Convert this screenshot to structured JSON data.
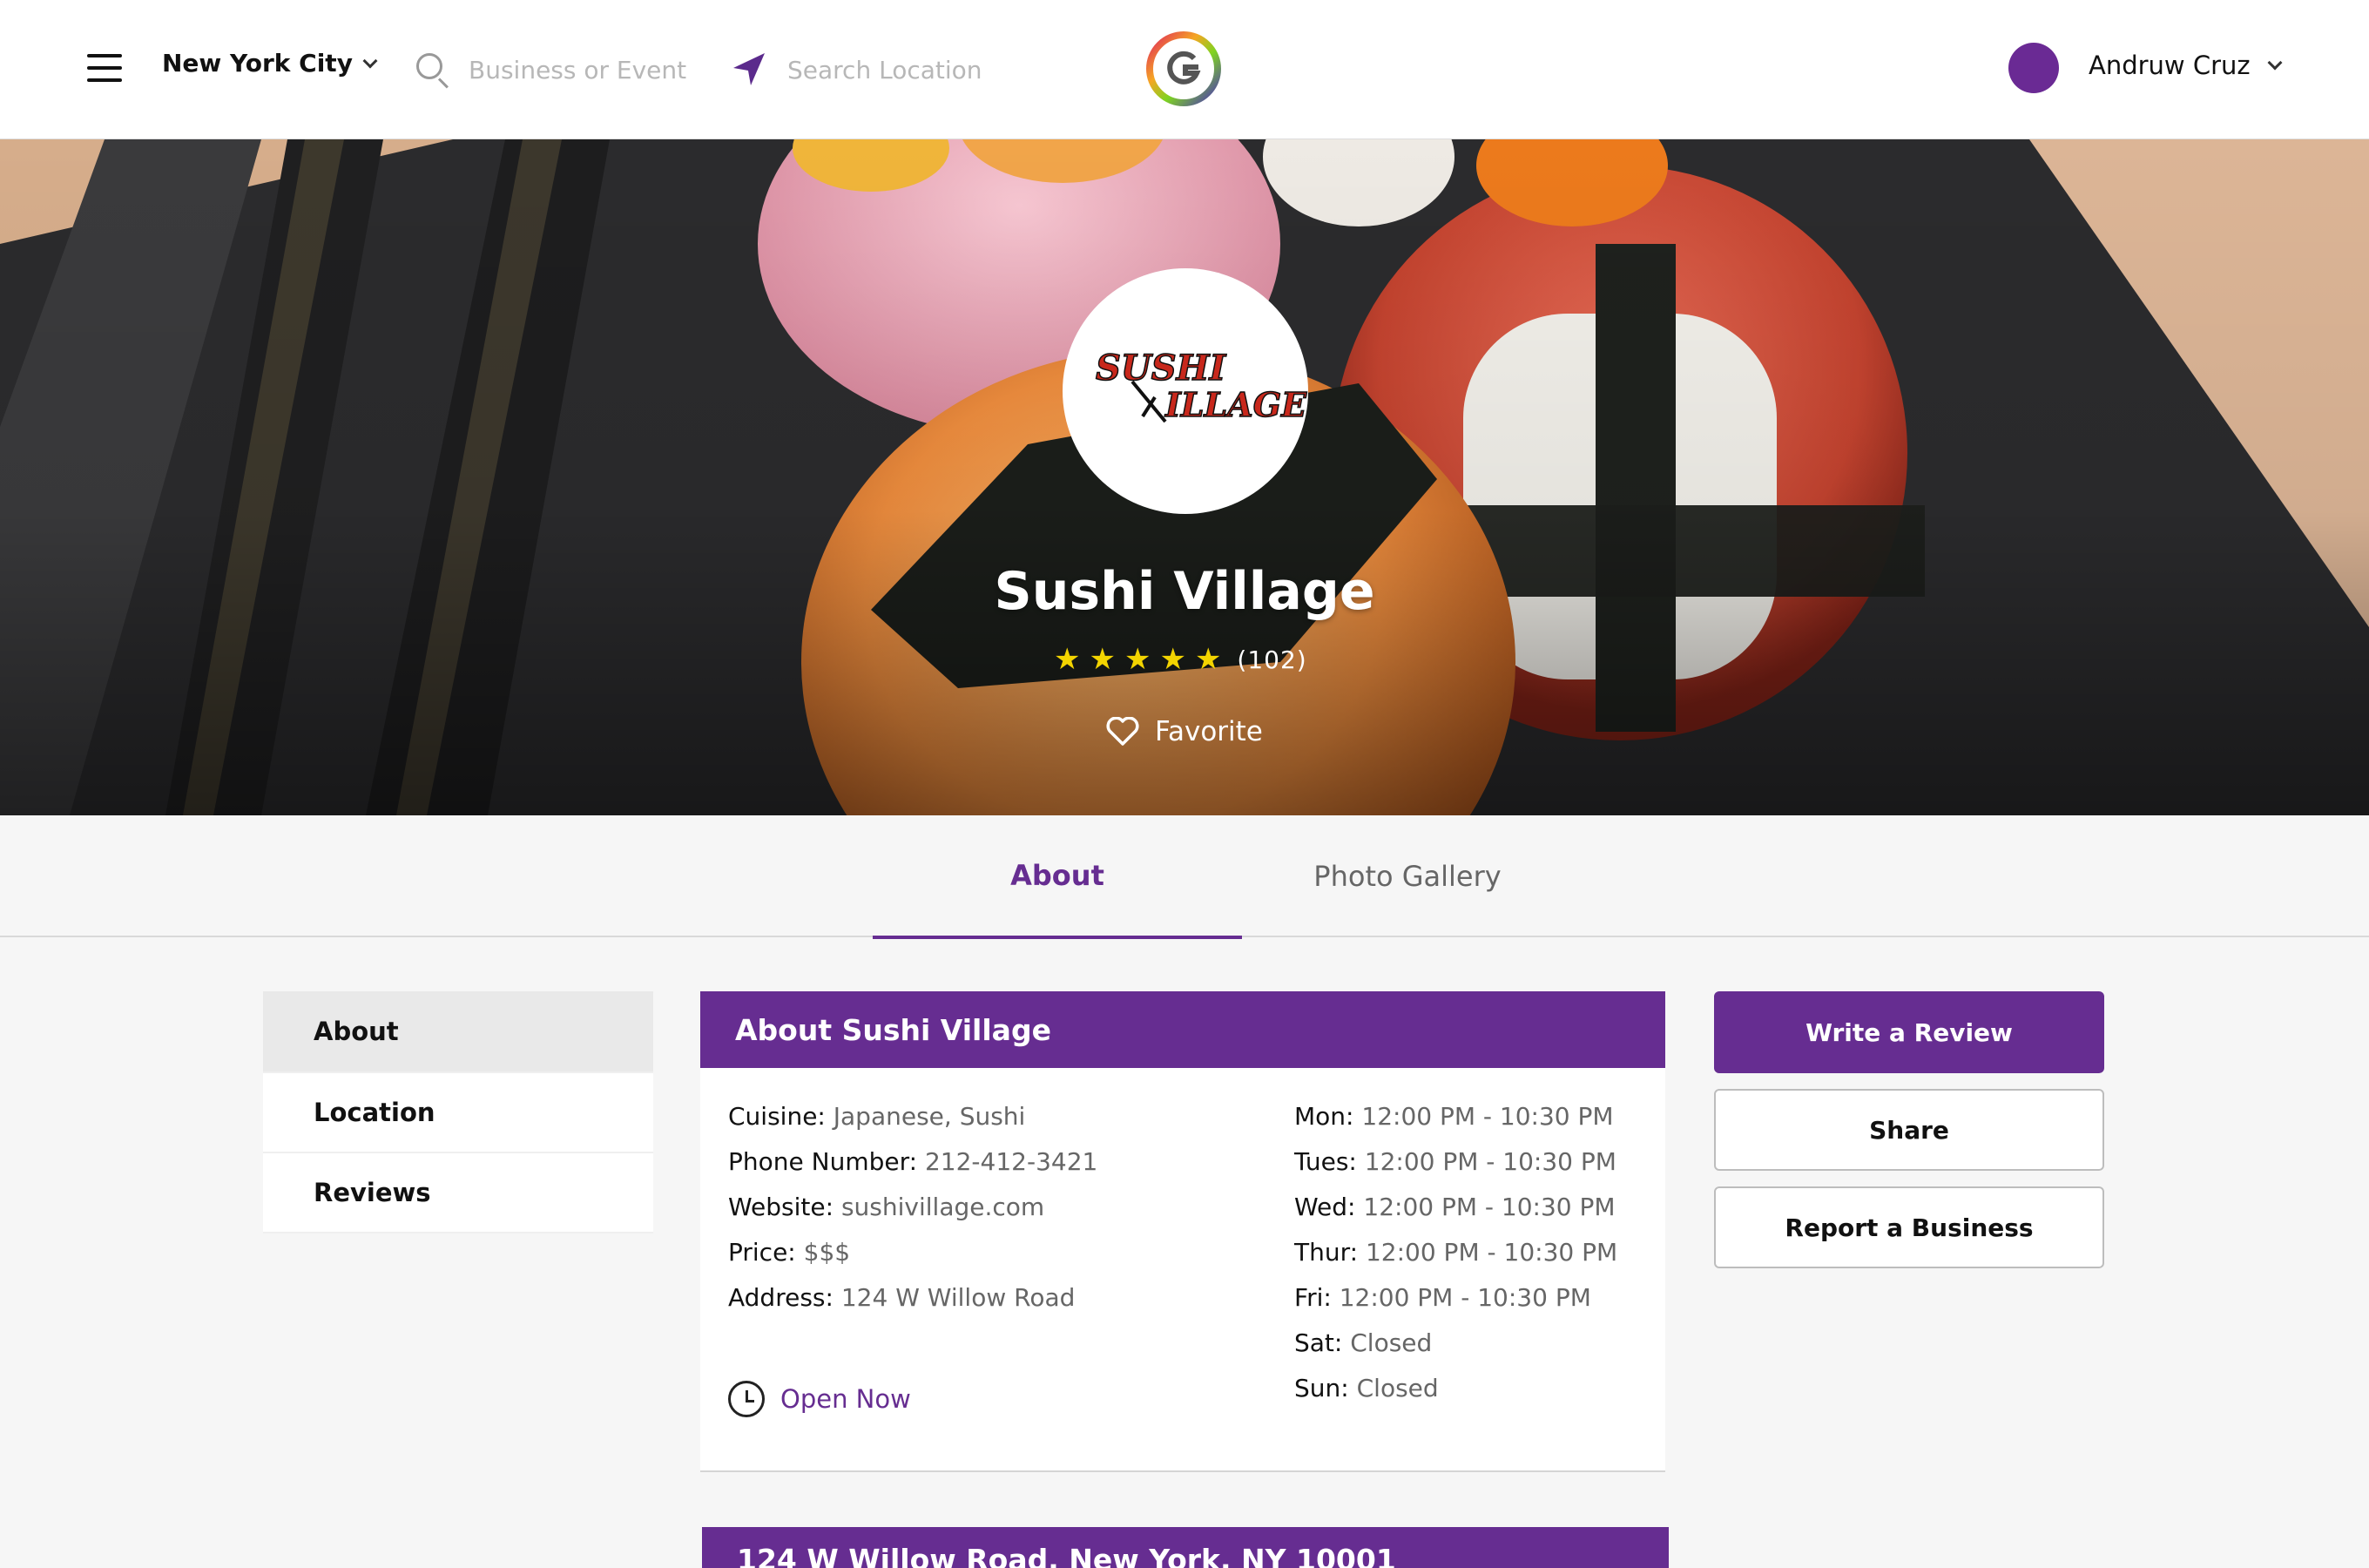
{
  "header": {
    "city": "New York City",
    "search_business_placeholder": "Business or Event",
    "search_location_placeholder": "Search Location",
    "user_name": "Andruw Cruz"
  },
  "hero": {
    "business_name": "Sushi Village",
    "logo_text_line1": "SUSHI",
    "logo_text_line2": "ILLAGE",
    "rating_stars": 5,
    "rating_count": "(102)",
    "favorite_label": "Favorite"
  },
  "tabs": [
    {
      "label": "About",
      "active": true
    },
    {
      "label": "Photo Gallery",
      "active": false
    }
  ],
  "side_nav": [
    {
      "label": "About",
      "active": true
    },
    {
      "label": "Location",
      "active": false
    },
    {
      "label": "Reviews",
      "active": false
    }
  ],
  "about_card": {
    "title": "About Sushi Village",
    "details": [
      {
        "key": "Cuisine:",
        "value": "Japanese, Sushi"
      },
      {
        "key": "Phone Number:",
        "value": "212-412-3421"
      },
      {
        "key": "Website:",
        "value": "sushivillage.com"
      },
      {
        "key": "Price:",
        "value": "$$$"
      },
      {
        "key": "Address:",
        "value": "124 W Willow Road"
      }
    ],
    "hours": [
      {
        "day": "Mon:",
        "time": "12:00 PM - 10:30 PM"
      },
      {
        "day": "Tues:",
        "time": "12:00 PM - 10:30 PM"
      },
      {
        "day": "Wed:",
        "time": "12:00 PM - 10:30 PM"
      },
      {
        "day": "Thur:",
        "time": "12:00 PM - 10:30 PM"
      },
      {
        "day": "Fri:",
        "time": "12:00 PM - 10:30 PM"
      },
      {
        "day": "Sat:",
        "time": "Closed"
      },
      {
        "day": "Sun:",
        "time": "Closed"
      }
    ],
    "open_status": "Open Now"
  },
  "location_card": {
    "title": "124 W Willow Road, New York, NY 10001"
  },
  "actions": {
    "write_review": "Write a Review",
    "share": "Share",
    "report": "Report a Business"
  },
  "colors": {
    "brand_purple": "#662d91",
    "star_yellow": "#f3d400"
  }
}
